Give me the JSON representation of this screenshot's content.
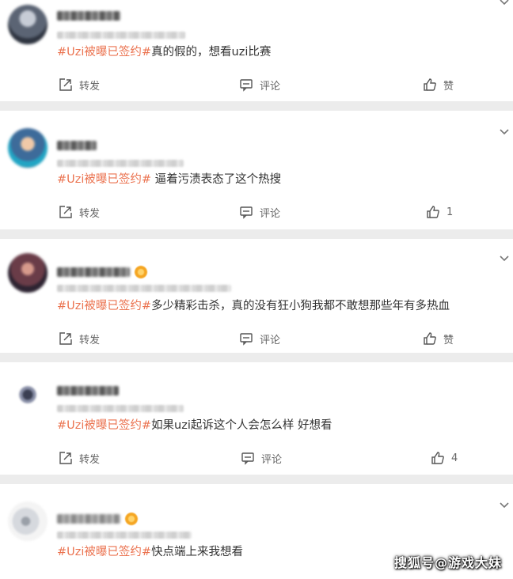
{
  "posts": [
    {
      "hashtag": "#Uzi被曝已签约#",
      "text": "真的假的，想看uzi比赛",
      "repost_label": "转发",
      "comment_label": "评论",
      "like_label": "赞"
    },
    {
      "hashtag": "#Uzi被曝已签约#",
      "text": " 逼着污渍表态了这个热搜",
      "repost_label": "转发",
      "comment_label": "评论",
      "like_label": "1"
    },
    {
      "hashtag": "#Uzi被曝已签约#",
      "text": "多少精彩击杀，真的没有狂小狗我都不敢想那些年有多热血",
      "repost_label": "转发",
      "comment_label": "评论",
      "like_label": "赞"
    },
    {
      "hashtag": "#Uzi被曝已签约#",
      "text": "如果uzi起诉这个人会怎么样 好想看",
      "repost_label": "转发",
      "comment_label": "评论",
      "like_label": "4"
    },
    {
      "hashtag": "#Uzi被曝已签约#",
      "text": "快点端上来我想看"
    }
  ],
  "watermark": "搜狐号@游戏大妹",
  "icons": {
    "repost": "repost-icon",
    "comment": "comment-icon",
    "like": "thumbs-up-icon",
    "more": "chevron-down-icon"
  }
}
